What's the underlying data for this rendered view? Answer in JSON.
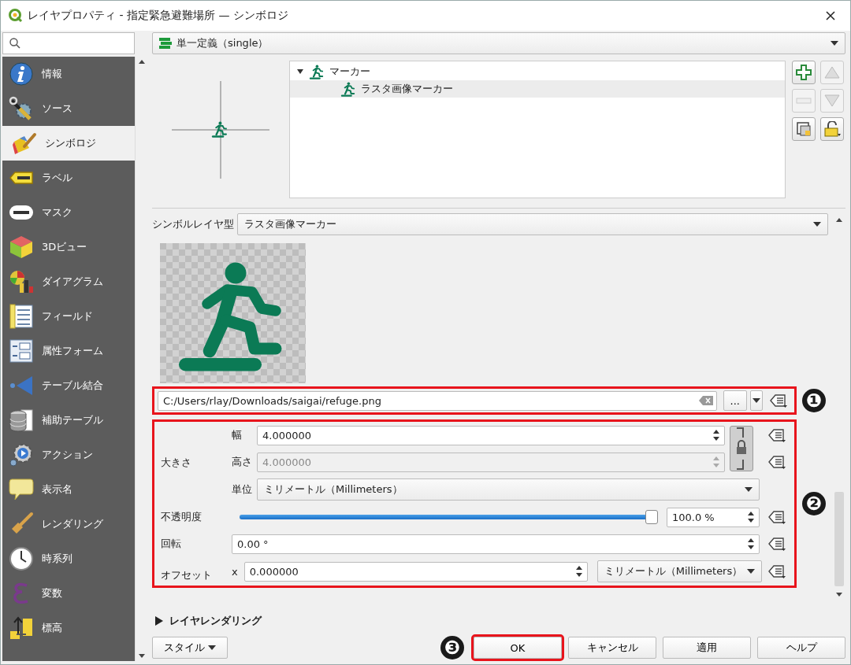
{
  "window": {
    "title": "レイヤプロパティ - 指定緊急避難場所 — シンボロジ"
  },
  "sidebar": {
    "items": [
      {
        "label": "情報",
        "selected": false
      },
      {
        "label": "ソース",
        "selected": false
      },
      {
        "label": "シンボロジ",
        "selected": true
      },
      {
        "label": "ラベル",
        "selected": false
      },
      {
        "label": "マスク",
        "selected": false
      },
      {
        "label": "3Dビュー",
        "selected": false
      },
      {
        "label": "ダイアグラム",
        "selected": false
      },
      {
        "label": "フィールド",
        "selected": false
      },
      {
        "label": "属性フォーム",
        "selected": false
      },
      {
        "label": "テーブル結合",
        "selected": false
      },
      {
        "label": "補助テーブル",
        "selected": false
      },
      {
        "label": "アクション",
        "selected": false
      },
      {
        "label": "表示名",
        "selected": false
      },
      {
        "label": "レンダリング",
        "selected": false
      },
      {
        "label": "時系列",
        "selected": false
      },
      {
        "label": "変数",
        "selected": false
      },
      {
        "label": "標高",
        "selected": false
      }
    ]
  },
  "renderer": {
    "value": "単一定義（single）"
  },
  "symbol_tree": [
    {
      "label": "マーカー",
      "expanded": true,
      "selected": false,
      "children": [
        {
          "label": "ラスタ画像マーカー",
          "selected": true
        }
      ]
    }
  ],
  "symbol_layer_type": {
    "label": "シンボルレイヤ型",
    "value": "ラスタ画像マーカー"
  },
  "image_path": {
    "value": "C:/Users/rlay/Downloads/saigai/refuge.png",
    "highlighted": true,
    "callout": "❶",
    "browse": "..."
  },
  "properties": {
    "highlighted": true,
    "callout": "❷",
    "size_label": "大きさ",
    "width": {
      "label": "幅",
      "value": "4.000000",
      "disabled": false
    },
    "height": {
      "label": "高さ",
      "value": "4.000000",
      "disabled": true
    },
    "locked": true,
    "unit": {
      "label": "単位",
      "value": "ミリメートル（Millimeters）"
    },
    "opacity": {
      "label": "不透明度",
      "level": 1.0,
      "reading": "100.0 %"
    },
    "rotation": {
      "label": "回転",
      "value": "0.00 °"
    },
    "offset": {
      "label": "オフセット",
      "x_label": "x",
      "x_value": "0.000000",
      "unit": "ミリメートル（Millimeters）"
    }
  },
  "layer_rendering": {
    "label": "レイヤレンダリング",
    "expanded": false
  },
  "buttons": [
    {
      "label": "スタイル",
      "kind": "menu",
      "highlighted": false
    },
    {
      "label": "OK",
      "kind": "push",
      "highlighted": true,
      "callout": "❸"
    },
    {
      "label": "キャンセル",
      "kind": "push",
      "highlighted": false
    },
    {
      "label": "適用",
      "kind": "push",
      "highlighted": false
    },
    {
      "label": "ヘルプ",
      "kind": "push",
      "highlighted": false
    }
  ]
}
